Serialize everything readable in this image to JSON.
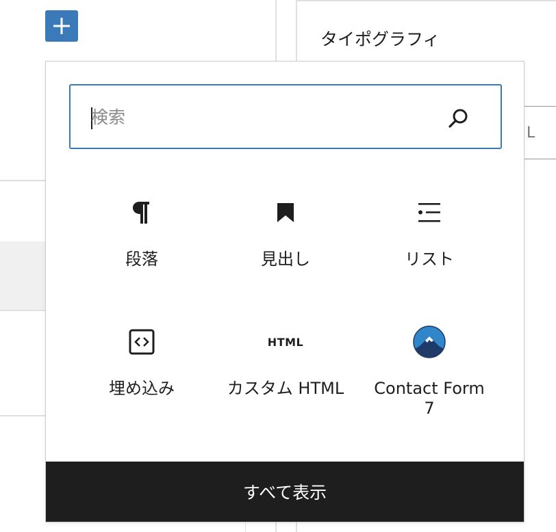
{
  "editor": {
    "add_block_label": "+",
    "sidebar_panel_title": "タイポグラフィ",
    "sidebar_field_partial": "L"
  },
  "inserter": {
    "search_placeholder": "検索",
    "search_value": "",
    "blocks": [
      {
        "label": "段落",
        "icon": "paragraph-icon"
      },
      {
        "label": "見出し",
        "icon": "heading-bookmark-icon"
      },
      {
        "label": "リスト",
        "icon": "list-icon"
      },
      {
        "label": "埋め込み",
        "icon": "embed-icon"
      },
      {
        "label": "カスタム HTML",
        "icon_text": "HTML",
        "icon": "html-icon"
      },
      {
        "label": "Contact Form 7",
        "icon": "contact-form-7-mountain-icon"
      }
    ],
    "browse_all_label": "すべて表示"
  },
  "colors": {
    "accent": "#3a7ab8",
    "footer_bg": "#1e1e1e",
    "text": "#1e1e1e"
  }
}
